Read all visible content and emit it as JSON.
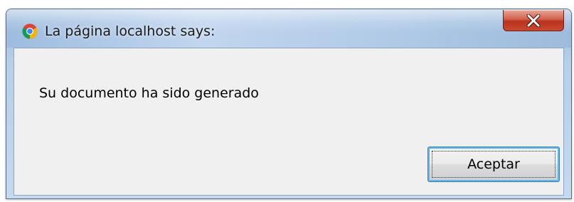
{
  "window": {
    "title": "La página localhost says:",
    "icon": "chrome-icon",
    "close_icon": "close-icon"
  },
  "dialog": {
    "message": "Su documento ha sido generado",
    "ok_label": "Aceptar"
  },
  "colors": {
    "close_button": "#c9482f",
    "focus_ring": "#5fb6e8",
    "content_bg": "#f0f0f0"
  }
}
